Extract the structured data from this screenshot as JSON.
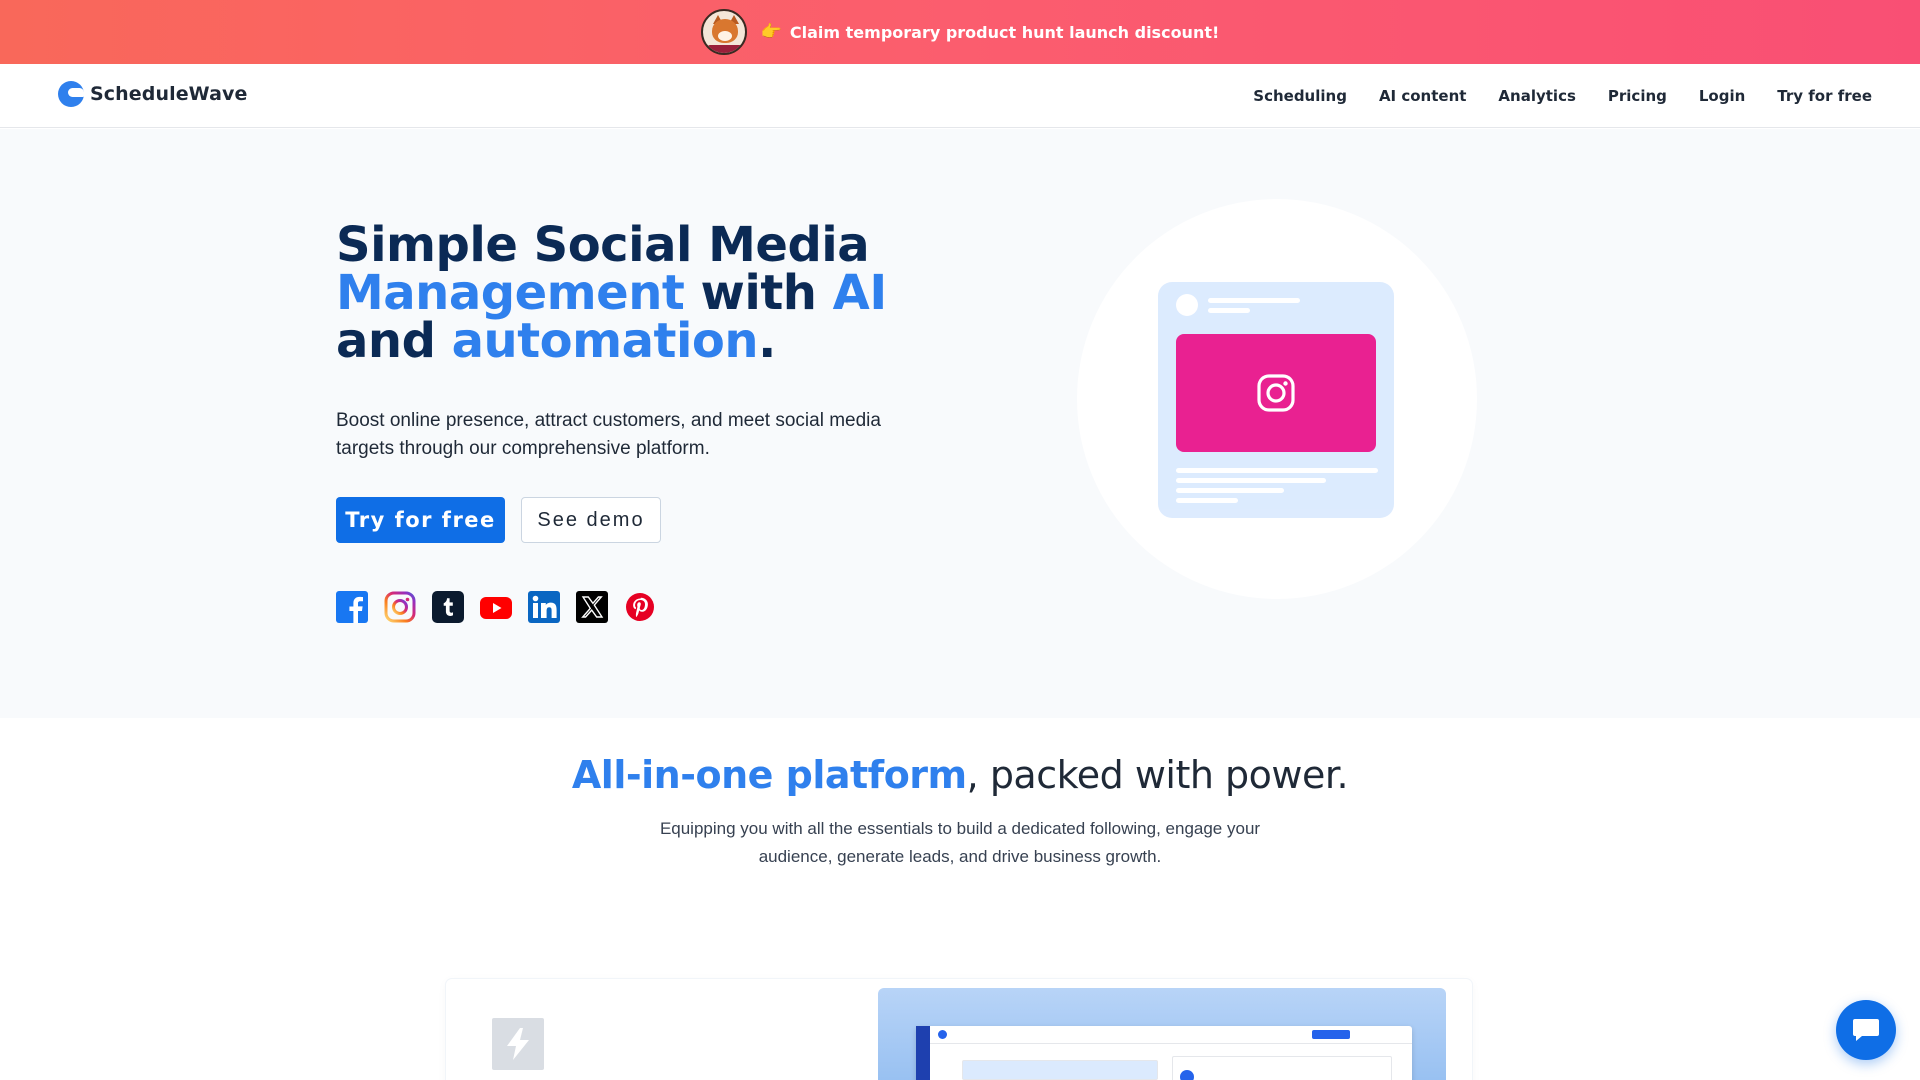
{
  "banner": {
    "emoji": "👉",
    "text": "Claim temporary product hunt launch discount!"
  },
  "nav": {
    "logo_text": "ScheduleWave",
    "links": [
      "Scheduling",
      "AI content",
      "Analytics",
      "Pricing",
      "Login",
      "Try for free"
    ]
  },
  "hero": {
    "title": {
      "line1": "Simple Social Media",
      "line2_a": "Management",
      "line2_b": " with ",
      "line2_c": "AI",
      "line3_a": "and ",
      "line3_b": "automation",
      "line3_c": "."
    },
    "subtitle": "Boost online presence, attract customers, and meet social media targets through our comprehensive platform.",
    "primary_button": "Try for free",
    "secondary_button": "See demo",
    "social_icons": [
      "facebook-icon",
      "instagram-icon",
      "tumblr-icon",
      "youtube-icon",
      "linkedin-icon",
      "x-icon",
      "pinterest-icon"
    ]
  },
  "features": {
    "title_highlight": "All-in-one platform",
    "title_rest": ", packed with power.",
    "subtitle": "Equipping you with all the essentials to build a dedicated following, engage your audience, generate leads, and drive business growth."
  },
  "colors": {
    "accent": "#2f80ed",
    "primary_button": "#0f6ee6",
    "heading_dark": "#0b2a55",
    "instagram_card": "#e8168c"
  }
}
